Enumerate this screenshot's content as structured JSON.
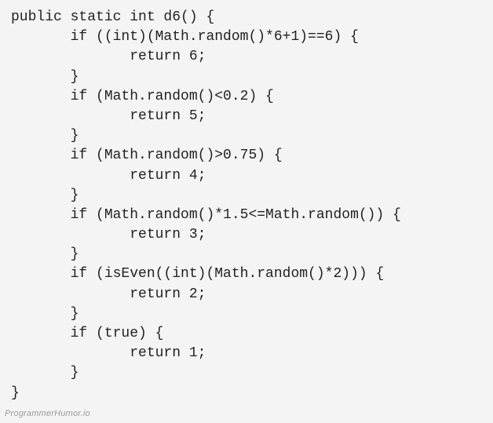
{
  "code": {
    "lines": [
      "public static int d6() {",
      "       if ((int)(Math.random()*6+1)==6) {",
      "              return 6;",
      "       }",
      "       if (Math.random()<0.2) {",
      "              return 5;",
      "       }",
      "       if (Math.random()>0.75) {",
      "              return 4;",
      "       }",
      "       if (Math.random()*1.5<=Math.random()) {",
      "              return 3;",
      "       }",
      "       if (isEven((int)(Math.random()*2))) {",
      "              return 2;",
      "       }",
      "       if (true) {",
      "              return 1;",
      "       }",
      "}"
    ]
  },
  "watermark": "ProgrammerHumor.io"
}
